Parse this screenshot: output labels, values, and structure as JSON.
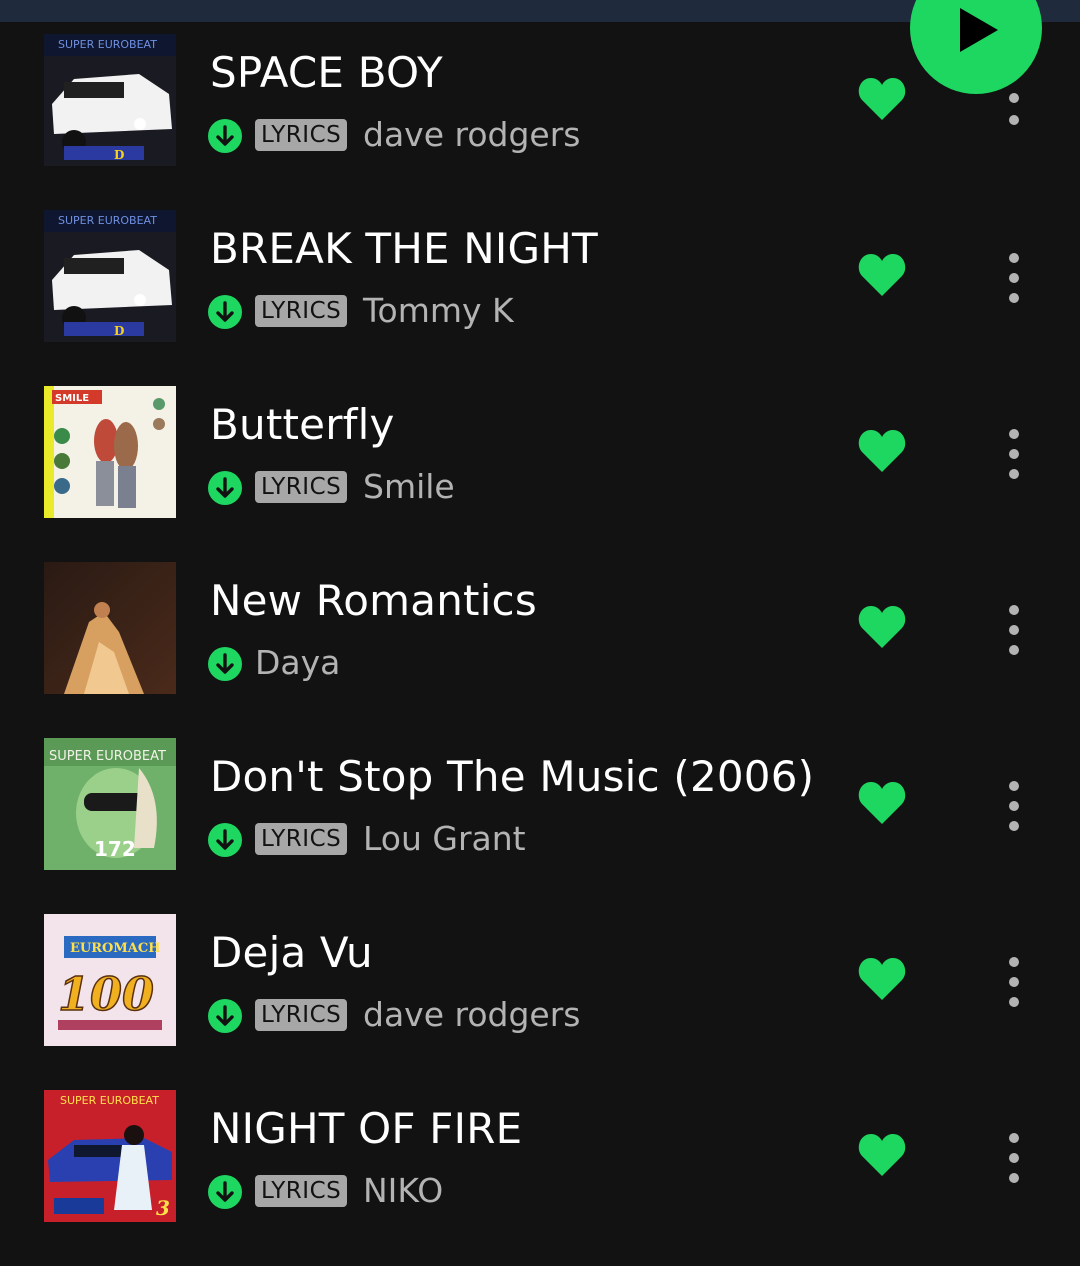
{
  "colors": {
    "accent": "#1ed760",
    "background": "#121212",
    "text": "#ffffff",
    "subtext": "#b3b3b3"
  },
  "tracks": [
    {
      "title": "SPACE BOY",
      "lyrics": "LYRICS",
      "artist": "dave rodgers",
      "downloaded": true,
      "liked": true,
      "cover_text": "SUPER EUROBEAT"
    },
    {
      "title": "BREAK THE NIGHT",
      "lyrics": "LYRICS",
      "artist": "Tommy K",
      "downloaded": true,
      "liked": true,
      "cover_text": "SUPER EUROBEAT"
    },
    {
      "title": "Butterfly",
      "lyrics": "LYRICS",
      "artist": "Smile",
      "downloaded": true,
      "liked": true,
      "cover_text": "SMILE"
    },
    {
      "title": "New Romantics",
      "lyrics": "",
      "artist": "Daya",
      "downloaded": true,
      "liked": true,
      "cover_text": ""
    },
    {
      "title": "Don't Stop The Music (2006)",
      "lyrics": "LYRICS",
      "artist": "Lou Grant",
      "downloaded": true,
      "liked": true,
      "cover_text": "SUPER EUROBEAT",
      "cover_number": "172"
    },
    {
      "title": "Deja Vu",
      "lyrics": "LYRICS",
      "artist": "dave rodgers",
      "downloaded": true,
      "liked": true,
      "cover_text": "EUROMACH",
      "cover_number": "100"
    },
    {
      "title": "NIGHT OF FIRE",
      "lyrics": "LYRICS",
      "artist": "NIKO",
      "downloaded": true,
      "liked": true,
      "cover_text": "SUPER EUROBEAT"
    }
  ],
  "icons": {
    "download": "download-circle-icon",
    "heart": "heart-filled-icon",
    "more": "more-vertical-icon",
    "play": "play-icon"
  }
}
